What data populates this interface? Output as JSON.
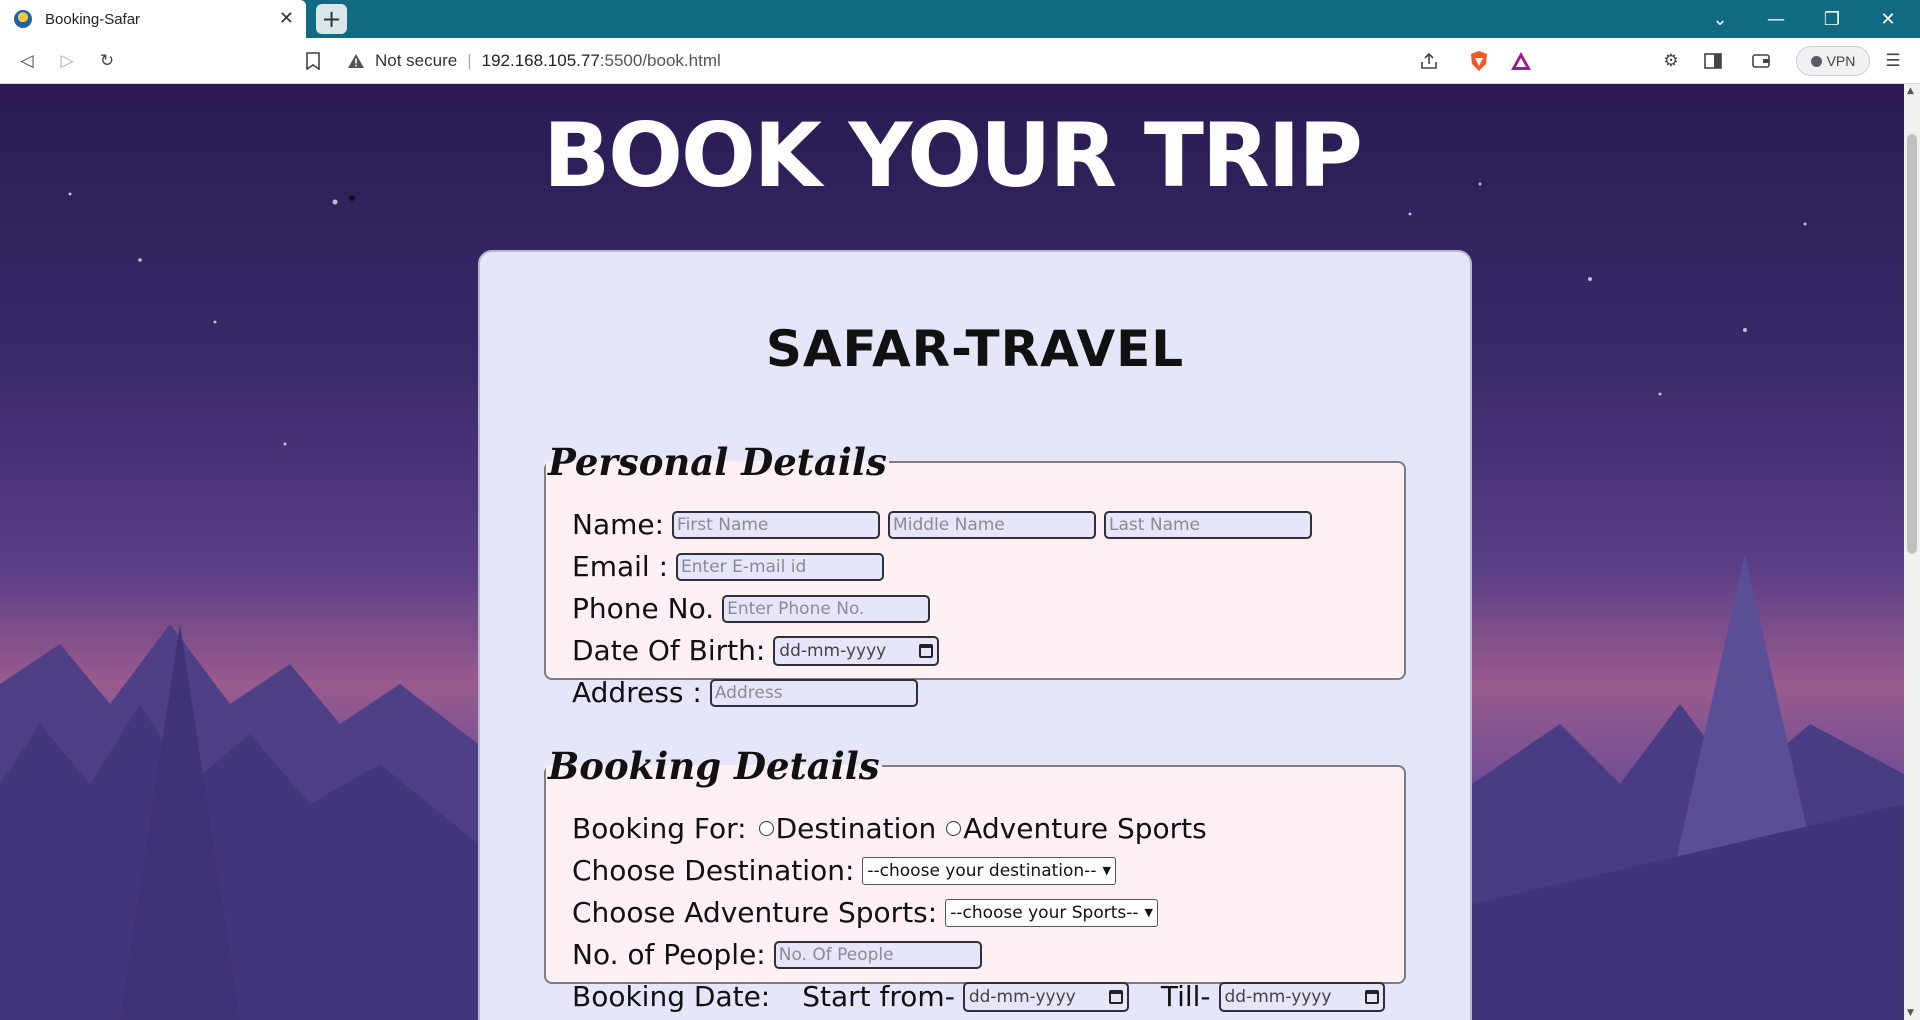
{
  "browser": {
    "tab_title": "Booking-Safar",
    "tab_close": "✕",
    "new_tab": "+",
    "security_label": "Not secure",
    "url_host": "192.168.105.77",
    "url_path": ":5500/book.html",
    "vpn_label": "VPN"
  },
  "page": {
    "hero_title": "BOOK YOUR TRIP",
    "brand": "SAFAR-TRAVEL"
  },
  "personal": {
    "legend": "Personal Details",
    "name_label": "Name:",
    "first_name_ph": "First Name",
    "middle_name_ph": "Middle Name",
    "last_name_ph": "Last Name",
    "email_label": "Email :",
    "email_ph": "Enter E-mail id",
    "phone_label": "Phone No.",
    "phone_ph": "Enter Phone No.",
    "dob_label": "Date Of Birth:",
    "dob_value": "dd-mm-yyyy",
    "address_label": "Address :",
    "address_ph": "Address"
  },
  "booking": {
    "legend": "Booking Details",
    "for_label": "Booking For:",
    "option_destination": "Destination",
    "option_adventure": "Adventure Sports",
    "dest_label": "Choose Destination:",
    "dest_select": "--choose your destination--",
    "sports_label": "Choose Adventure Sports:",
    "sports_select": "--choose your Sports--",
    "people_label": "No. of People:",
    "people_ph": "No. Of People",
    "date_label": "Booking Date:",
    "start_label": "Start from-",
    "start_value": "dd-mm-yyyy",
    "till_label": "Till-",
    "till_value": "dd-mm-yyyy"
  },
  "colors": {
    "titlebar": "#106b82",
    "card_bg": "#e6e6fa",
    "fieldset_bg": "#fff0f4"
  }
}
